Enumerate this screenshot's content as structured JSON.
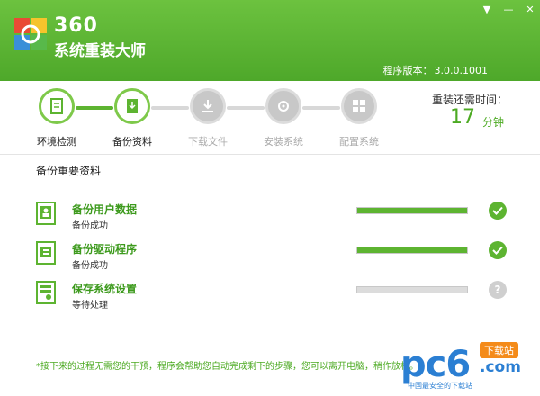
{
  "header": {
    "brand_number": "360",
    "brand_name": "系统重装大师",
    "version_label": "程序版本：",
    "version_value": "3.0.0.1001",
    "controls": {
      "menu": "▼",
      "minimize": "—",
      "close": "✕"
    }
  },
  "steps": [
    {
      "label": "环境检测",
      "state": "done",
      "icon": "document-check-icon"
    },
    {
      "label": "备份资料",
      "state": "active",
      "icon": "backup-file-icon"
    },
    {
      "label": "下载文件",
      "state": "pending",
      "icon": "download-icon"
    },
    {
      "label": "安装系统",
      "state": "pending",
      "icon": "install-gear-icon"
    },
    {
      "label": "配置系统",
      "state": "pending",
      "icon": "windows-config-icon"
    }
  ],
  "remaining": {
    "label": "重装还需时间：",
    "value": "17",
    "unit": "分钟"
  },
  "section_title": "备份重要资料",
  "tasks": [
    {
      "name": "备份用户数据",
      "status": "备份成功",
      "progress": 1.0,
      "state": "done",
      "icon": "user-data-icon"
    },
    {
      "name": "备份驱动程序",
      "status": "备份成功",
      "progress": 1.0,
      "state": "done",
      "icon": "driver-icon"
    },
    {
      "name": "保存系统设置",
      "status": "等待处理",
      "progress": 0.0,
      "state": "waiting",
      "icon": "system-settings-icon",
      "wait_symbol": "?"
    }
  ],
  "footer_note": "*接下来的过程无需您的干预，程序会帮助您自动完成剩下的步骤，您可以离开电脑，稍作放松。",
  "watermark": {
    "brand": "pc6",
    "badge": "下载站",
    "domain": ".com",
    "tagline": "中国最安全的下载站"
  },
  "colors": {
    "accent_green": "#5db431",
    "header_green": "#5ab332",
    "inactive_gray": "#d8d8d8"
  }
}
